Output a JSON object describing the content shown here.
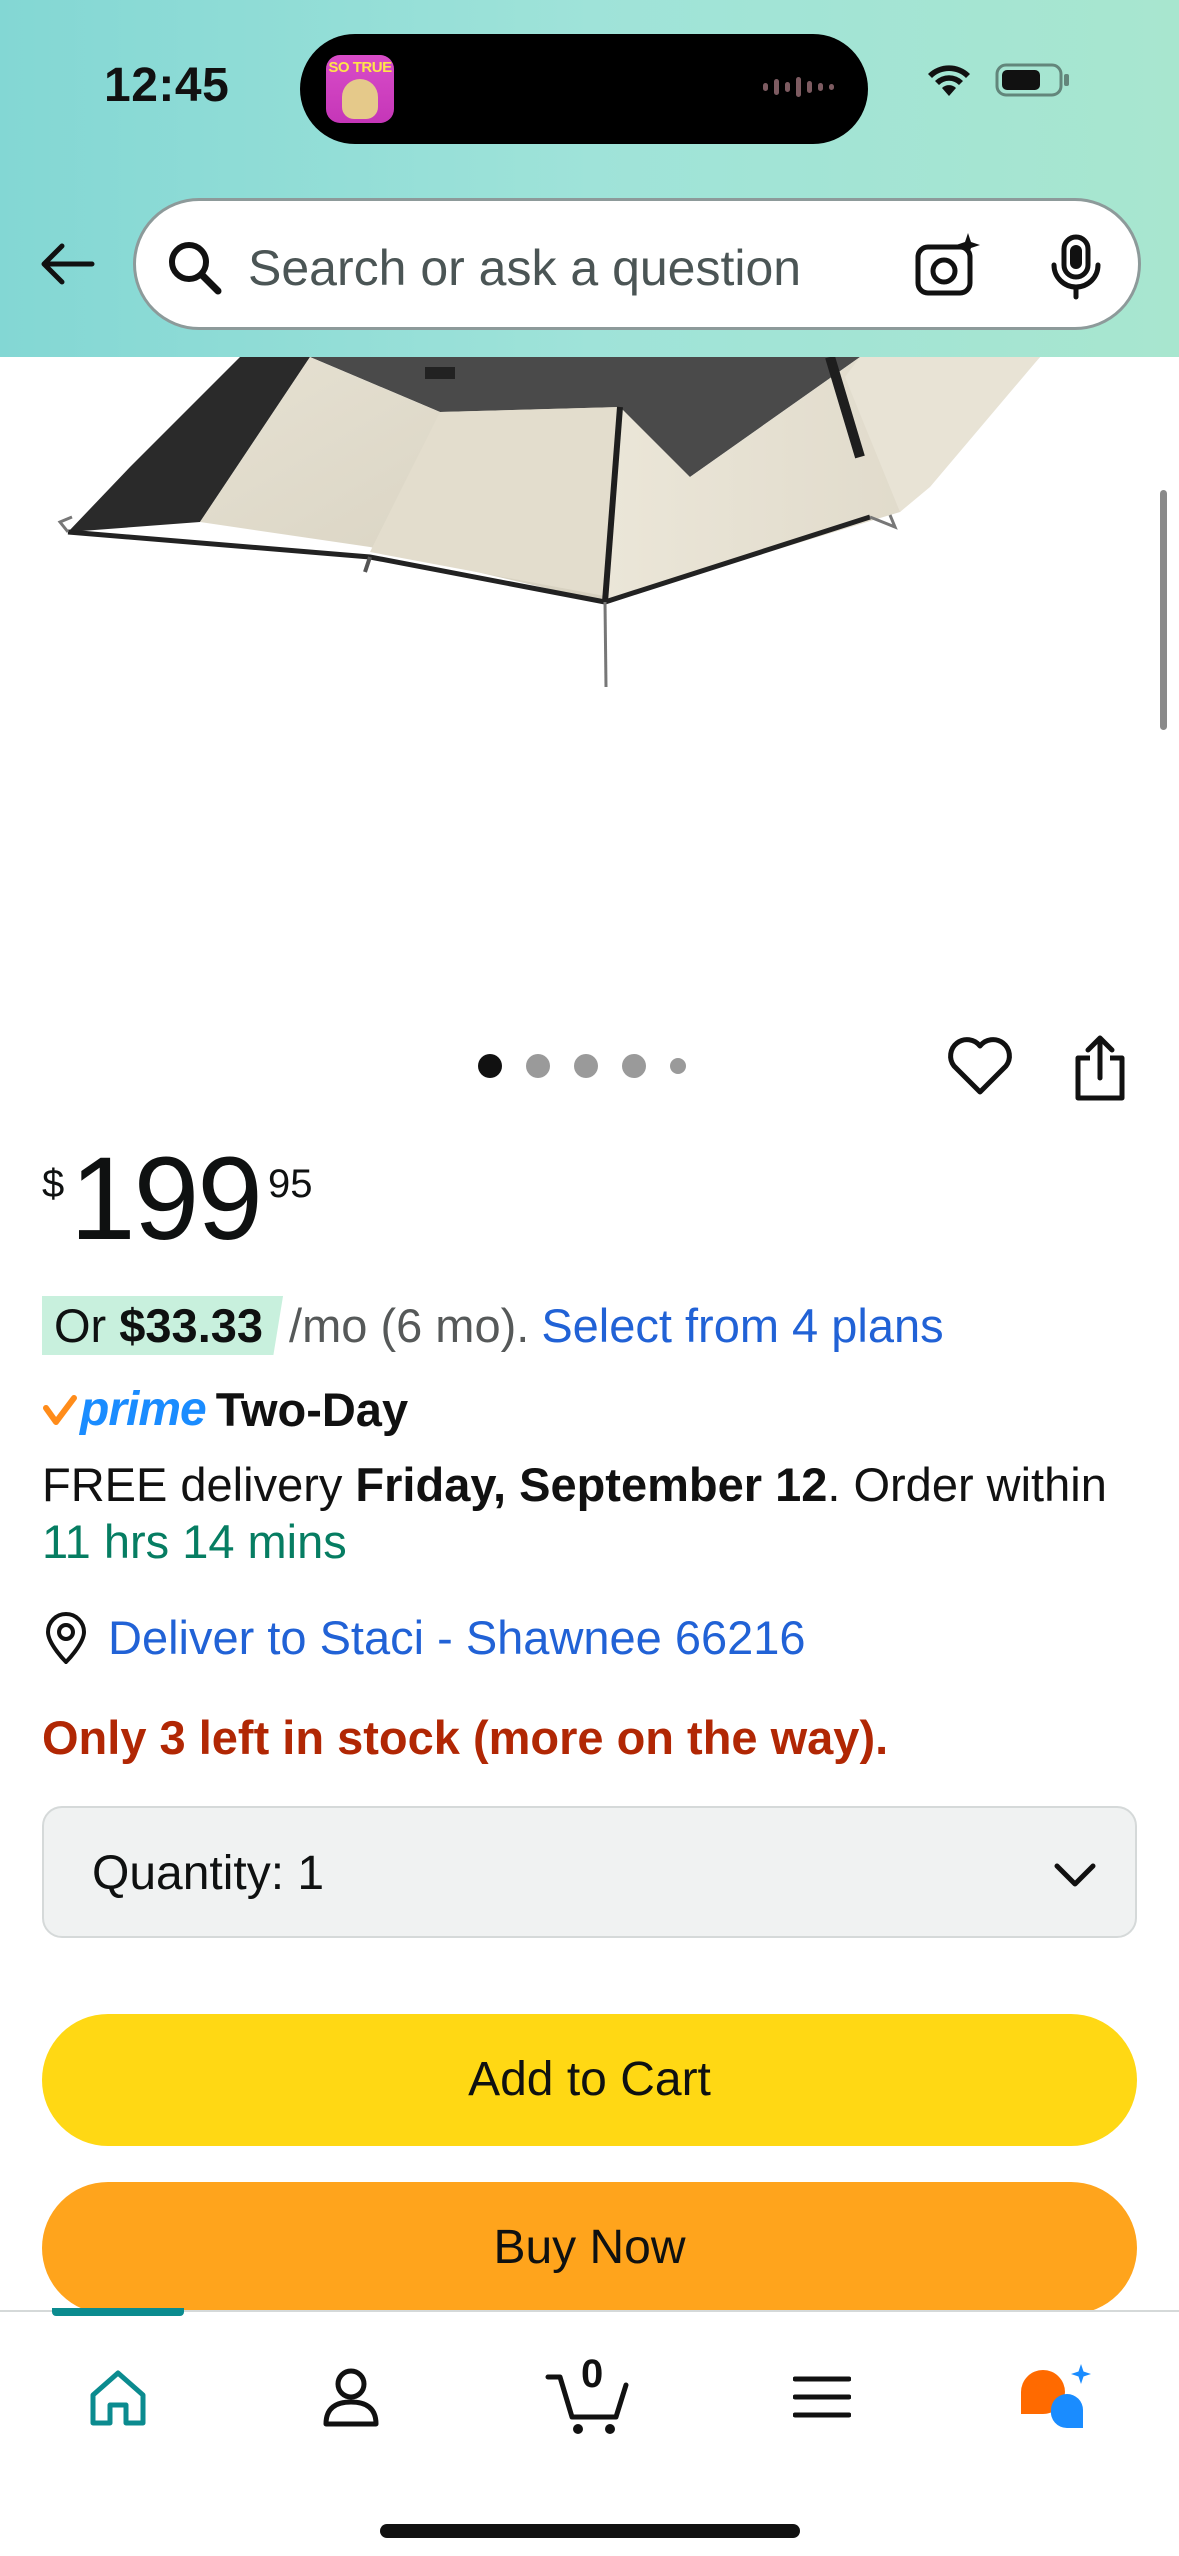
{
  "status_bar": {
    "time": "12:45",
    "activity_avatar_text": "SO TRUE"
  },
  "header": {
    "search_placeholder": "Search or ask a question"
  },
  "gallery": {
    "image_count": 5,
    "active_index": 0
  },
  "price": {
    "symbol": "$",
    "whole": "199",
    "fraction": "95"
  },
  "payment_plan": {
    "prefix": "Or",
    "amount": "$33.33",
    "term": "/mo (6 mo).",
    "link": "Select from 4 plans"
  },
  "prime": {
    "label": "prime",
    "speed": "Two-Day"
  },
  "delivery": {
    "text_before": "FREE delivery ",
    "date": "Friday, September 12",
    "text_after": ". Order within",
    "countdown": "11 hrs 14 mins"
  },
  "location": {
    "text": "Deliver to Staci - Shawnee 66216"
  },
  "stock": {
    "text": "Only 3 left in stock (more on the way)."
  },
  "quantity": {
    "label": "Quantity:  1"
  },
  "buttons": {
    "add_to_cart": "Add to Cart",
    "buy_now": "Buy Now"
  },
  "bottom_nav": {
    "cart_count": "0",
    "items": [
      "home-icon",
      "account-icon",
      "cart-icon",
      "menu-icon",
      "rufus-assistant-icon"
    ],
    "active": "home-icon"
  },
  "colors": {
    "header_gradient_start": "#83d7d4",
    "header_gradient_end": "#a8e6cf",
    "add_to_cart": "#ffd814",
    "buy_now": "#ffa41c",
    "link": "#2162d6",
    "stock_warning": "#b12704",
    "countdown": "#067d62",
    "prime_blue": "#1a8cff",
    "nav_active": "#0b8b8f"
  }
}
